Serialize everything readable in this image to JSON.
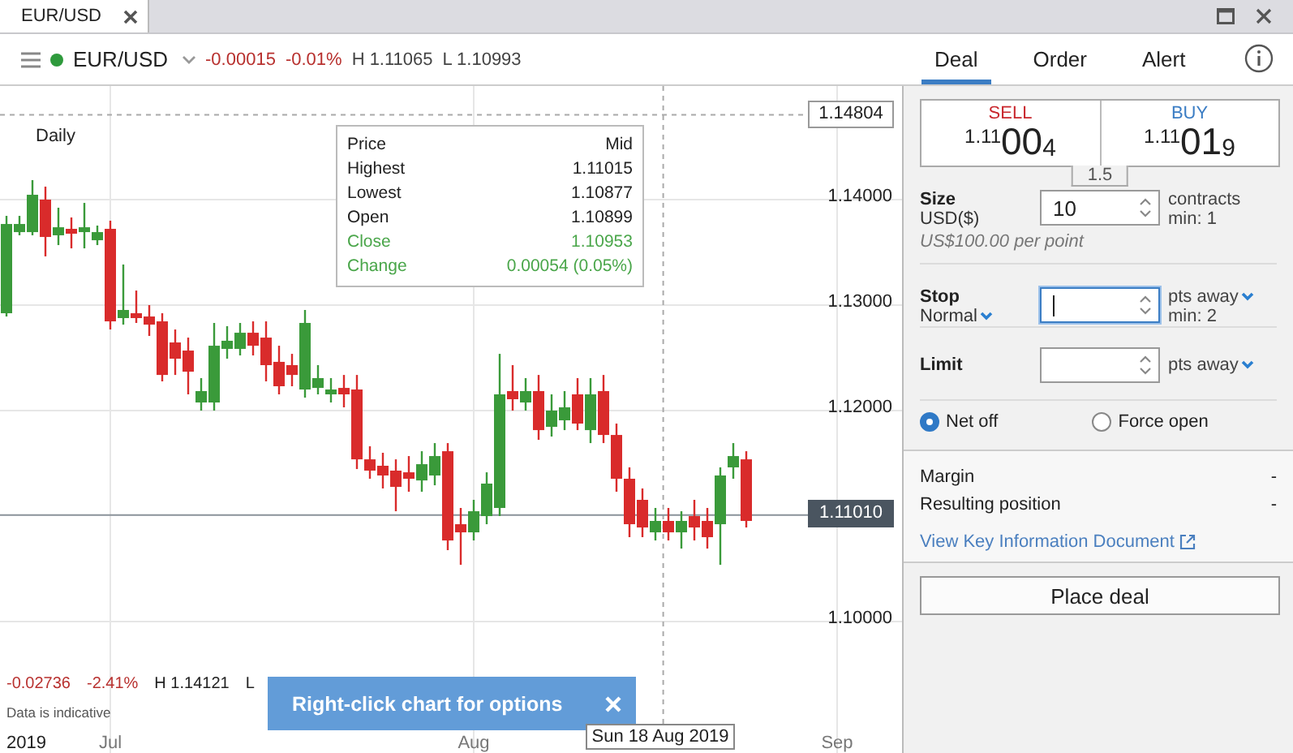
{
  "window": {
    "tabs": [
      {
        "label": "EUR/USD",
        "selected": true
      }
    ]
  },
  "instrument": {
    "market_open": true,
    "name": "EUR/USD",
    "change": "-0.00015",
    "change_pct": "-0.01%",
    "high": "H 1.11065",
    "low": "L 1.10993"
  },
  "chart": {
    "period": "Daily",
    "tooltip": [
      {
        "label": "Price",
        "value": "Mid",
        "kind": "plain"
      },
      {
        "label": "Highest",
        "value": "1.11015",
        "kind": "plain"
      },
      {
        "label": "Lowest",
        "value": "1.10877",
        "kind": "plain"
      },
      {
        "label": "Open",
        "value": "1.10899",
        "kind": "plain"
      },
      {
        "label": "Close",
        "value": "1.10953",
        "kind": "positive"
      },
      {
        "label": "Change",
        "value": "0.00054 (0.05%)",
        "kind": "positive"
      }
    ],
    "chart_data": {
      "type": "candlestick",
      "categories": [
        null,
        null,
        null,
        null,
        null,
        null,
        null,
        null,
        "Jul",
        null,
        null,
        null,
        null,
        null,
        null,
        null,
        null,
        null,
        null,
        null,
        null,
        null,
        null,
        null,
        null,
        null,
        null,
        null,
        null,
        null,
        null,
        null,
        null,
        null,
        null,
        null,
        "Aug",
        null,
        null,
        null,
        null,
        null,
        null,
        null,
        null,
        null,
        null,
        null,
        null,
        null,
        null,
        null,
        null,
        null,
        null,
        null,
        null,
        null,
        null,
        null,
        null,
        null,
        null,
        null,
        "Sep"
      ],
      "ohlc": [
        [
          1.12923,
          1.13846,
          1.12892,
          1.13769
        ],
        [
          1.13692,
          1.13846,
          1.13662,
          1.13769
        ],
        [
          1.13692,
          1.14185,
          1.13662,
          1.14046
        ],
        [
          1.14,
          1.14123,
          1.13462,
          1.13646
        ],
        [
          1.13662,
          1.13923,
          1.13569,
          1.13738
        ],
        [
          1.13723,
          1.13831,
          1.13538,
          1.13677
        ],
        [
          1.13692,
          1.13969,
          1.13538,
          1.13738
        ],
        [
          1.13615,
          1.13754,
          1.13569,
          1.13692
        ],
        [
          1.13723,
          1.138,
          1.12769,
          1.12846
        ],
        [
          1.12877,
          1.13385,
          1.12815,
          1.12954
        ],
        [
          1.12923,
          1.13138,
          1.12831,
          1.12877
        ],
        [
          1.12892,
          1.13,
          1.12708,
          1.12815
        ],
        [
          1.12846,
          1.12923,
          1.12277,
          1.12338
        ],
        [
          1.12646,
          1.12769,
          1.12338,
          1.12492
        ],
        [
          1.12569,
          1.12692,
          1.12154,
          1.12369
        ],
        [
          1.12077,
          1.12308,
          1.12,
          1.12185
        ],
        [
          1.12077,
          1.12831,
          1.12,
          1.12615
        ],
        [
          1.12585,
          1.128,
          1.12492,
          1.12662
        ],
        [
          1.12585,
          1.12831,
          1.12523,
          1.12738
        ],
        [
          1.12738,
          1.12846,
          1.12523,
          1.12615
        ],
        [
          1.12692,
          1.12846,
          1.12277,
          1.12431
        ],
        [
          1.12462,
          1.12615,
          1.12154,
          1.12231
        ],
        [
          1.12431,
          1.12538,
          1.12231,
          1.12338
        ],
        [
          1.122,
          1.12954,
          1.12123,
          1.12831
        ],
        [
          1.12215,
          1.12431,
          1.12154,
          1.12308
        ],
        [
          1.12154,
          1.12308,
          1.12077,
          1.122
        ],
        [
          1.12215,
          1.12338,
          1.12031,
          1.12154
        ],
        [
          1.122,
          1.12338,
          1.11446,
          1.11538
        ],
        [
          1.11538,
          1.11662,
          1.11354,
          1.11431
        ],
        [
          1.11477,
          1.116,
          1.11262,
          1.11385
        ],
        [
          1.11431,
          1.11538,
          1.11046,
          1.11277
        ],
        [
          1.11415,
          1.11569,
          1.11231,
          1.11354
        ],
        [
          1.11338,
          1.11615,
          1.11231,
          1.11492
        ],
        [
          1.11385,
          1.11692,
          1.11292,
          1.11569
        ],
        [
          1.11615,
          1.11692,
          1.10677,
          1.10769
        ],
        [
          1.10923,
          1.11077,
          1.10538,
          1.10846
        ],
        [
          1.10846,
          1.11154,
          1.10769,
          1.11046
        ],
        [
          1.11,
          1.11415,
          1.10923,
          1.11308
        ],
        [
          1.11077,
          1.12538,
          1.11,
          1.12154
        ],
        [
          1.12185,
          1.12431,
          1.12,
          1.12108
        ],
        [
          1.12077,
          1.12308,
          1.12,
          1.12185
        ],
        [
          1.12185,
          1.12338,
          1.11723,
          1.11815
        ],
        [
          1.11846,
          1.12154,
          1.11754,
          1.12
        ],
        [
          1.11908,
          1.12185,
          1.11815,
          1.12031
        ],
        [
          1.12154,
          1.12308,
          1.11815,
          1.11877
        ],
        [
          1.11815,
          1.12308,
          1.11692,
          1.12154
        ],
        [
          1.12185,
          1.12338,
          1.11692,
          1.11769
        ],
        [
          1.11769,
          1.11877,
          1.11231,
          1.11354
        ],
        [
          1.11354,
          1.11462,
          1.108,
          1.10923
        ],
        [
          1.11154,
          1.11262,
          1.108,
          1.10892
        ],
        [
          1.10846,
          1.11077,
          1.10769,
          1.10954
        ],
        [
          1.10954,
          1.11077,
          1.10769,
          1.10846
        ],
        [
          1.10846,
          1.11046,
          1.10692,
          1.10954
        ],
        [
          1.11,
          1.11154,
          1.10769,
          1.10892
        ],
        [
          1.10954,
          1.11077,
          1.10692,
          1.108
        ],
        [
          1.10923,
          1.11462,
          1.10538,
          1.11385
        ],
        [
          1.11462,
          1.11692,
          1.11354,
          1.11569
        ],
        [
          1.11538,
          1.11615,
          1.10892,
          1.10954
        ],
        null,
        null,
        null,
        null,
        null,
        null,
        null
      ],
      "ylim": [
        1.08708,
        1.15077
      ],
      "grid": true,
      "yticks": [
        {
          "value": 1.14,
          "label": "1.14000"
        },
        {
          "value": 1.13,
          "label": "1.13000"
        },
        {
          "value": 1.12,
          "label": "1.12000"
        },
        {
          "value": 1.1,
          "label": "1.10000"
        }
      ],
      "ref_lines": [
        {
          "axis": "y",
          "value": 1.14804,
          "label": "1.14804",
          "color": "#aaaaaa"
        },
        {
          "axis": "y",
          "value": 1.1101,
          "label": "1.11010",
          "color": "#8a929a"
        }
      ]
    },
    "crosshair_date": "Sun 18 Aug 2019",
    "year": "2019",
    "stats": [
      {
        "text": "-0.02736",
        "kind": "negative"
      },
      {
        "text": "-2.41%",
        "kind": "negative"
      },
      {
        "text": "H 1.14121",
        "kind": "plain"
      },
      {
        "text": "L",
        "kind": "plain"
      }
    ],
    "disclaimer": "Data is indicative",
    "toast": {
      "message": "Right-click chart for options"
    }
  },
  "ticket": {
    "tabs": [
      {
        "label": "Deal",
        "selected": true
      },
      {
        "label": "Order",
        "selected": false
      },
      {
        "label": "Alert",
        "selected": false
      }
    ],
    "sell": {
      "label": "SELL",
      "prefix": "1.11",
      "big": "00",
      "suffix": "4"
    },
    "buy": {
      "label": "BUY",
      "prefix": "1.11",
      "big": "01",
      "suffix": "9"
    },
    "spread": "1.5",
    "size": {
      "label": "Size",
      "currency": "USD($)",
      "value": "10",
      "unit": "contracts",
      "min": "min: 1",
      "note": "US$100.00 per point"
    },
    "stop": {
      "label": "Stop",
      "type": "Normal",
      "focused": true,
      "unit": "pts away",
      "min": "min: 2"
    },
    "limit": {
      "label": "Limit",
      "focused": false,
      "unit": "pts away"
    },
    "options": [
      {
        "label": "Net off",
        "selected": true
      },
      {
        "label": "Force open",
        "selected": false
      }
    ],
    "info": [
      {
        "label": "Margin",
        "value": "-"
      },
      {
        "label": "Resulting position",
        "value": "-"
      }
    ],
    "link": "View Key Information Document",
    "submit": "Place deal"
  }
}
